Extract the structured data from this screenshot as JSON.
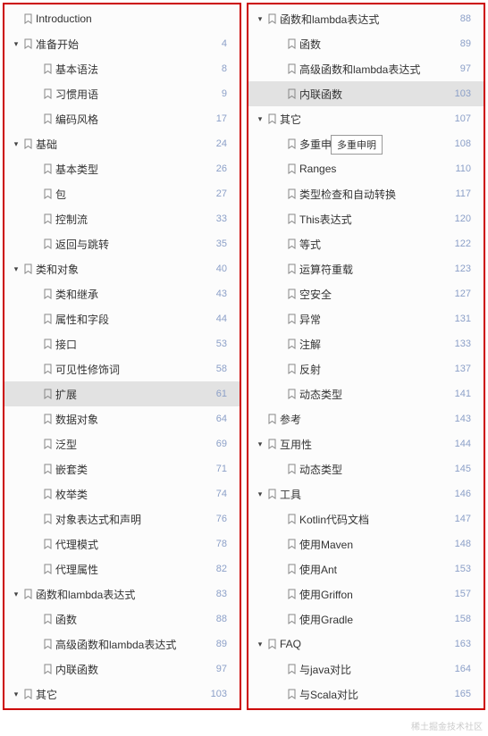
{
  "watermark": "稀土掘金技术社区",
  "tooltip": "多重申明",
  "left": [
    {
      "depth": 0,
      "caret": false,
      "label": "Introduction",
      "num": ""
    },
    {
      "depth": 0,
      "caret": true,
      "label": "准备开始",
      "num": "4"
    },
    {
      "depth": 1,
      "caret": false,
      "label": "基本语法",
      "num": "8"
    },
    {
      "depth": 1,
      "caret": false,
      "label": "习惯用语",
      "num": "9"
    },
    {
      "depth": 1,
      "caret": false,
      "label": "编码风格",
      "num": "17"
    },
    {
      "depth": 0,
      "caret": true,
      "label": "基础",
      "num": "24"
    },
    {
      "depth": 1,
      "caret": false,
      "label": "基本类型",
      "num": "26"
    },
    {
      "depth": 1,
      "caret": false,
      "label": "包",
      "num": "27"
    },
    {
      "depth": 1,
      "caret": false,
      "label": "控制流",
      "num": "33"
    },
    {
      "depth": 1,
      "caret": false,
      "label": "返回与跳转",
      "num": "35"
    },
    {
      "depth": 0,
      "caret": true,
      "label": "类和对象",
      "num": "40"
    },
    {
      "depth": 1,
      "caret": false,
      "label": "类和继承",
      "num": "43"
    },
    {
      "depth": 1,
      "caret": false,
      "label": "属性和字段",
      "num": "44"
    },
    {
      "depth": 1,
      "caret": false,
      "label": "接口",
      "num": "53"
    },
    {
      "depth": 1,
      "caret": false,
      "label": "可见性修饰词",
      "num": "58"
    },
    {
      "depth": 1,
      "caret": false,
      "label": "扩展",
      "num": "61",
      "hl": true
    },
    {
      "depth": 1,
      "caret": false,
      "label": "数据对象",
      "num": "64"
    },
    {
      "depth": 1,
      "caret": false,
      "label": "泛型",
      "num": "69"
    },
    {
      "depth": 1,
      "caret": false,
      "label": "嵌套类",
      "num": "71"
    },
    {
      "depth": 1,
      "caret": false,
      "label": "枚举类",
      "num": "74"
    },
    {
      "depth": 1,
      "caret": false,
      "label": "对象表达式和声明",
      "num": "76"
    },
    {
      "depth": 1,
      "caret": false,
      "label": "代理模式",
      "num": "78"
    },
    {
      "depth": 1,
      "caret": false,
      "label": "代理属性",
      "num": "82"
    },
    {
      "depth": 0,
      "caret": true,
      "label": "函数和lambda表达式",
      "num": "83"
    },
    {
      "depth": 1,
      "caret": false,
      "label": "函数",
      "num": "88"
    },
    {
      "depth": 1,
      "caret": false,
      "label": "高级函数和lambda表达式",
      "num": "89"
    },
    {
      "depth": 1,
      "caret": false,
      "label": "内联函数",
      "num": "97"
    },
    {
      "depth": 0,
      "caret": true,
      "label": "其它",
      "num": "103"
    }
  ],
  "right": [
    {
      "depth": 0,
      "caret": true,
      "label": "函数和lambda表达式",
      "num": "88"
    },
    {
      "depth": 1,
      "caret": false,
      "label": "函数",
      "num": "89"
    },
    {
      "depth": 1,
      "caret": false,
      "label": "高级函数和lambda表达式",
      "num": "97"
    },
    {
      "depth": 1,
      "caret": false,
      "label": "内联函数",
      "num": "103",
      "hl": true
    },
    {
      "depth": 0,
      "caret": true,
      "label": "其它",
      "num": "107"
    },
    {
      "depth": 1,
      "caret": false,
      "label": "多重申明",
      "num": "108",
      "tip": true
    },
    {
      "depth": 1,
      "caret": false,
      "label": "Ranges",
      "num": "110"
    },
    {
      "depth": 1,
      "caret": false,
      "label": "类型检查和自动转换",
      "num": "117"
    },
    {
      "depth": 1,
      "caret": false,
      "label": "This表达式",
      "num": "120"
    },
    {
      "depth": 1,
      "caret": false,
      "label": "等式",
      "num": "122"
    },
    {
      "depth": 1,
      "caret": false,
      "label": "运算符重载",
      "num": "123"
    },
    {
      "depth": 1,
      "caret": false,
      "label": "空安全",
      "num": "127"
    },
    {
      "depth": 1,
      "caret": false,
      "label": "异常",
      "num": "131"
    },
    {
      "depth": 1,
      "caret": false,
      "label": "注解",
      "num": "133"
    },
    {
      "depth": 1,
      "caret": false,
      "label": "反射",
      "num": "137"
    },
    {
      "depth": 1,
      "caret": false,
      "label": "动态类型",
      "num": "141"
    },
    {
      "depth": 0,
      "caret": false,
      "label": "参考",
      "num": "143"
    },
    {
      "depth": 0,
      "caret": true,
      "label": "互用性",
      "num": "144"
    },
    {
      "depth": 1,
      "caret": false,
      "label": "动态类型",
      "num": "145"
    },
    {
      "depth": 0,
      "caret": true,
      "label": "工具",
      "num": "146"
    },
    {
      "depth": 1,
      "caret": false,
      "label": "Kotlin代码文档",
      "num": "147"
    },
    {
      "depth": 1,
      "caret": false,
      "label": "使用Maven",
      "num": "148"
    },
    {
      "depth": 1,
      "caret": false,
      "label": "使用Ant",
      "num": "153"
    },
    {
      "depth": 1,
      "caret": false,
      "label": "使用Griffon",
      "num": "157"
    },
    {
      "depth": 1,
      "caret": false,
      "label": "使用Gradle",
      "num": "158"
    },
    {
      "depth": 0,
      "caret": true,
      "label": "FAQ",
      "num": "163"
    },
    {
      "depth": 1,
      "caret": false,
      "label": "与java对比",
      "num": "164"
    },
    {
      "depth": 1,
      "caret": false,
      "label": "与Scala对比",
      "num": "165"
    }
  ]
}
